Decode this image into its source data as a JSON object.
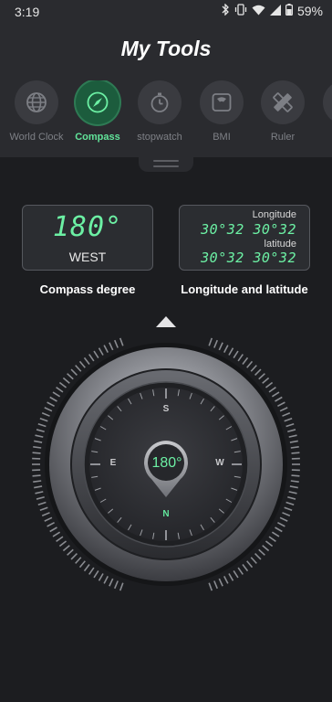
{
  "status_bar": {
    "time": "3:19",
    "battery": "59%",
    "icons": [
      "bluetooth-icon",
      "vibrate-icon",
      "wifi-icon",
      "signal-icon",
      "battery-icon"
    ]
  },
  "header": {
    "title": "My Tools"
  },
  "tools": [
    {
      "label": "World Clock",
      "icon": "globe-icon",
      "active": false
    },
    {
      "label": "Compass",
      "icon": "compass-icon",
      "active": true
    },
    {
      "label": "stopwatch",
      "icon": "stopwatch-icon",
      "active": false
    },
    {
      "label": "BMI",
      "icon": "scale-icon",
      "active": false
    },
    {
      "label": "Ruler",
      "icon": "ruler-icon",
      "active": false
    }
  ],
  "degree_panel": {
    "value": "180°",
    "direction": "WEST",
    "caption": "Compass degree"
  },
  "coord_panel": {
    "longitude_label": "Longitude",
    "longitude_value": "30°32  30°32",
    "latitude_label": "latitude",
    "latitude_value": "30°32  30°32",
    "caption": "Longitude and latitude"
  },
  "compass": {
    "reading": "180°",
    "letters": {
      "top": "S",
      "right": "W",
      "bottom": "N",
      "left": "E"
    }
  },
  "colors": {
    "accent": "#6cf0a4",
    "background": "#1c1d20",
    "panel": "#2a2b2f"
  }
}
